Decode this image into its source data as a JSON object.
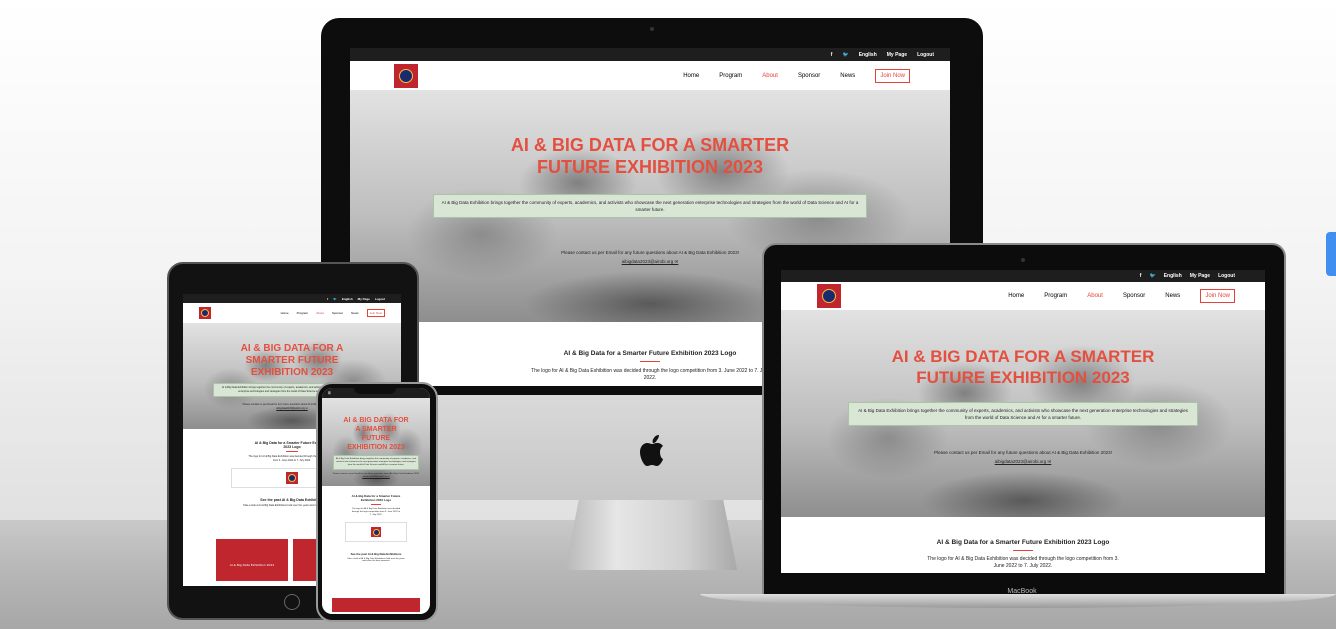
{
  "site": {
    "topbar": {
      "facebook_icon": "f",
      "twitter_icon": "twitter-bird",
      "language": "English",
      "my_page": "My Page",
      "logout": "Logout"
    },
    "nav": {
      "home": "Home",
      "program": "Program",
      "about": "About",
      "sponsor": "Sponsor",
      "news": "News",
      "join": "Join Now"
    },
    "hero": {
      "title": "AI & BIG DATA FOR A SMARTER FUTURE EXHIBITION 2023",
      "description": "AI & Big Data Exhibition brings together the community of experts, academics, and activists who showcase the next generation enterprise technologies and strategies from the world of Data Science and AI for a smarter future.",
      "contact": "Please contact us per Email for any future questions about AI & Big Data Exhibition 2023!",
      "email": "aibigdata2023@airobi.org ✉"
    },
    "logo_section": {
      "title": "AI & Big Data for a Smarter Future Exhibition 2023 Logo",
      "text": "The logo for AI & Big Data Exhibition was decided through the logo competition from 3. June 2022 to 7. July 2022."
    },
    "past": {
      "title": "See the past AI & Big Data Exhibitions",
      "text": "Take a look at AI & Big Data Exhibitions held over the years and relive the best moments",
      "tile_label": "AI & Big Data Exhibition 2022"
    }
  },
  "devices": {
    "laptop_label": "MacBook"
  },
  "colors": {
    "accent": "#e3443a",
    "brand_red": "#c0262e",
    "box_green": "#d9e6d5",
    "topbar": "#1e1e1e"
  }
}
